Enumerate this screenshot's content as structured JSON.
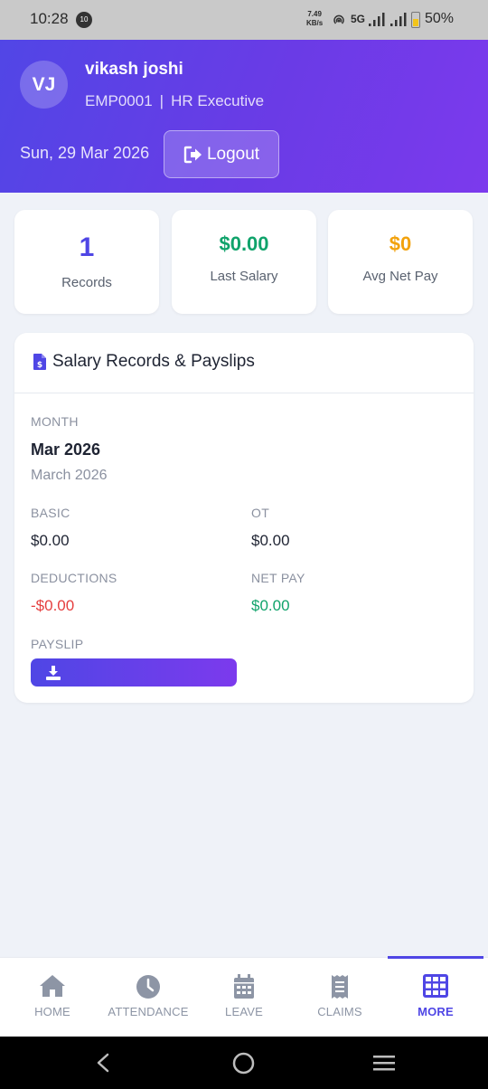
{
  "status_bar": {
    "time": "10:28",
    "notification_badge": "10",
    "net_speed_value": "7.49",
    "net_speed_unit": "KB/s",
    "network": "5G",
    "battery": "50%"
  },
  "header": {
    "avatar_initials": "VJ",
    "user_name": "vikash joshi",
    "employee_id": "EMP0001",
    "separator": "|",
    "role": "HR Executive",
    "date": "Sun, 29 Mar 2026",
    "logout_label": "Logout"
  },
  "stats": [
    {
      "value": "1",
      "label": "Records",
      "color": "#4f46e5"
    },
    {
      "value": "$0.00",
      "label": "Last Salary",
      "color": "#10a36b"
    },
    {
      "value": "$0",
      "label": "Avg Net Pay",
      "color": "#f2a20c"
    }
  ],
  "salary_section": {
    "title": "Salary Records & Payslips",
    "record": {
      "month_label": "MONTH",
      "month_value": "Mar 2026",
      "month_full": "March 2026",
      "basic_label": "BASIC",
      "basic_value": "$0.00",
      "ot_label": "OT",
      "ot_value": "$0.00",
      "deductions_label": "DEDUCTIONS",
      "deductions_value": "-$0.00",
      "net_pay_label": "NET PAY",
      "net_pay_value": "$0.00",
      "payslip_label": "PAYSLIP"
    }
  },
  "bottom_nav": {
    "items": [
      {
        "label": "HOME",
        "icon": "home-icon"
      },
      {
        "label": "ATTENDANCE",
        "icon": "clock-icon"
      },
      {
        "label": "LEAVE",
        "icon": "calendar-icon"
      },
      {
        "label": "CLAIMS",
        "icon": "receipt-icon"
      },
      {
        "label": "MORE",
        "icon": "grid-icon",
        "active": true
      }
    ],
    "accent_color": "#4f46e5"
  }
}
